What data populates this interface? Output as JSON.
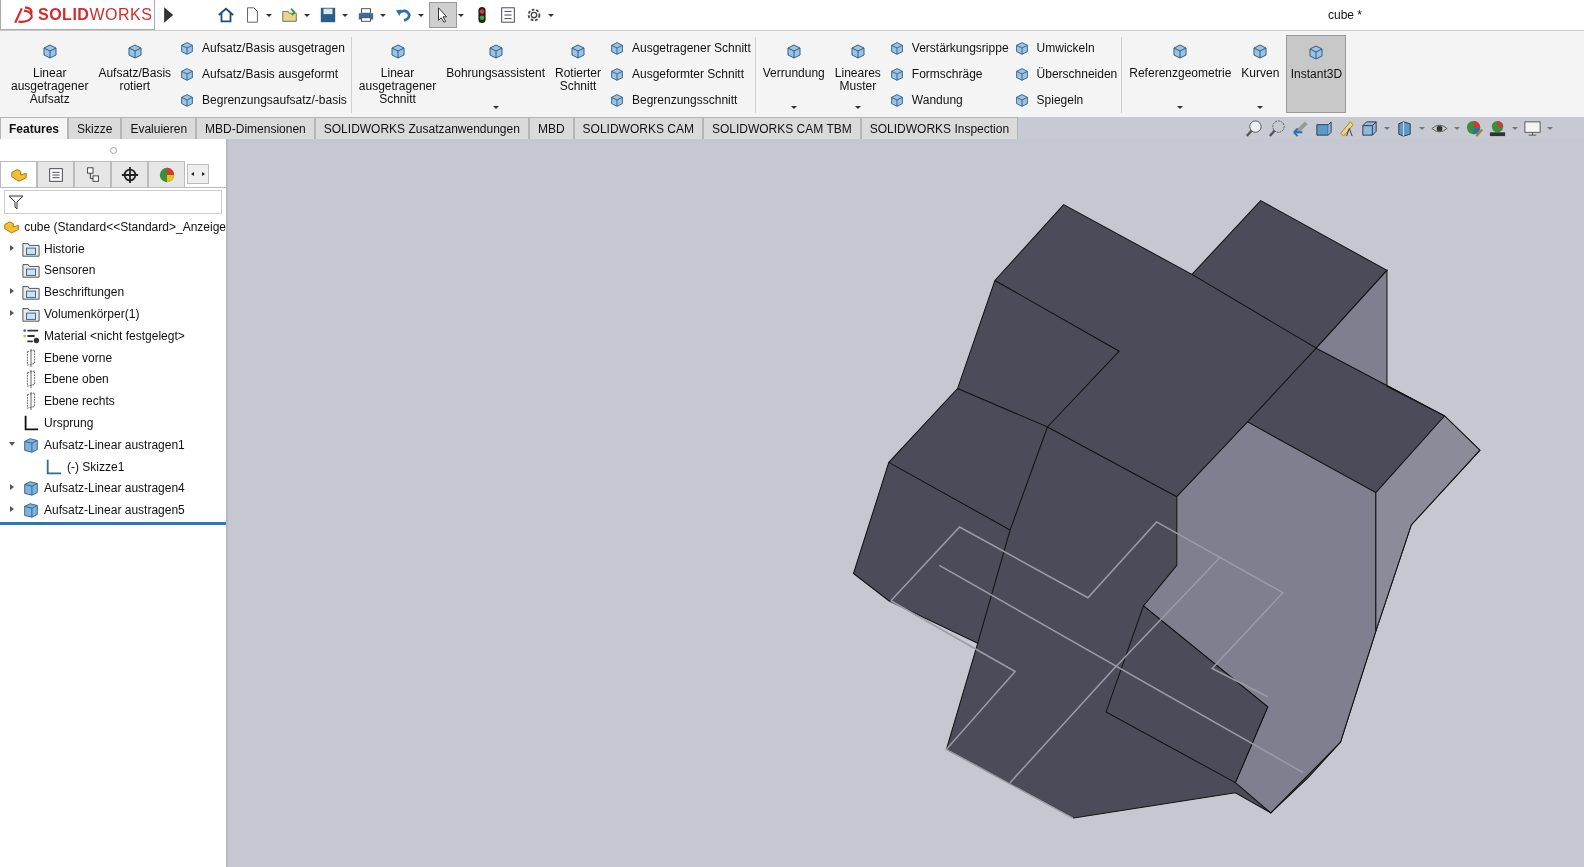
{
  "app": {
    "logo": "**SOLID**WORKS",
    "title": "cube *"
  },
  "ribbon": {
    "groups": [
      {
        "items": [
          {
            "kind": "large",
            "lines": [
              "Linear",
              "ausgetragener",
              "Aufsatz"
            ],
            "dropdown": false,
            "on": false
          },
          {
            "kind": "large",
            "lines": [
              "Aufsatz/Basis",
              "rotiert"
            ],
            "dropdown": false,
            "on": false
          },
          {
            "kind": "stack",
            "entries": [
              "Aufsatz/Basis ausgetragen",
              "Aufsatz/Basis ausgeformt",
              "Begrenzungsaufsatz/-basis"
            ]
          }
        ]
      },
      {
        "items": [
          {
            "kind": "large",
            "lines": [
              "Linear",
              "ausgetragener",
              "Schnitt"
            ],
            "dropdown": false,
            "on": false
          },
          {
            "kind": "large",
            "lines": [
              "Bohrungsassistent"
            ],
            "dropdown": true,
            "on": false
          },
          {
            "kind": "large",
            "lines": [
              "Rotierter",
              "Schnitt"
            ],
            "dropdown": false,
            "on": false
          },
          {
            "kind": "stack",
            "entries": [
              "Ausgetragener Schnitt",
              "Ausgeformter Schnitt",
              "Begrenzungsschnitt"
            ]
          }
        ]
      },
      {
        "items": [
          {
            "kind": "large",
            "lines": [
              "Verrundung"
            ],
            "dropdown": true,
            "on": false
          },
          {
            "kind": "large",
            "lines": [
              "Lineares",
              "Muster"
            ],
            "dropdown": true,
            "on": false
          },
          {
            "kind": "stack",
            "entries": [
              "Verstärkungsrippe",
              "Formschräge",
              "Wandung"
            ]
          },
          {
            "kind": "stack",
            "entries": [
              "Umwickeln",
              "Überschneiden",
              "Spiegeln"
            ]
          }
        ]
      },
      {
        "items": [
          {
            "kind": "large",
            "lines": [
              "Referenzgeometrie"
            ],
            "dropdown": true,
            "on": false
          },
          {
            "kind": "large",
            "lines": [
              "Kurven"
            ],
            "dropdown": true,
            "on": false
          },
          {
            "kind": "large",
            "lines": [
              "Instant3D"
            ],
            "dropdown": false,
            "on": true
          }
        ]
      }
    ]
  },
  "tabs": [
    {
      "label": "Features",
      "selected": true
    },
    {
      "label": "Skizze",
      "selected": false
    },
    {
      "label": "Evaluieren",
      "selected": false
    },
    {
      "label": "MBD-Dimensionen",
      "selected": false
    },
    {
      "label": "SOLIDWORKS Zusatzanwendungen",
      "selected": false
    },
    {
      "label": "MBD",
      "selected": false
    },
    {
      "label": "SOLIDWORKS CAM",
      "selected": false
    },
    {
      "label": "SOLIDWORKS CAM TBM",
      "selected": false
    },
    {
      "label": "SOLIDWORKS Inspection",
      "selected": false
    }
  ],
  "panel_tabs": [
    {
      "selected": true
    },
    {
      "selected": false
    },
    {
      "selected": false
    },
    {
      "selected": false
    },
    {
      "selected": false
    }
  ],
  "tree": {
    "root": "cube  (Standard<<Standard>_Anzeige",
    "items": [
      {
        "kind": "folder",
        "label": "Historie",
        "expanded": false
      },
      {
        "kind": "folder",
        "label": "Sensoren"
      },
      {
        "kind": "folder",
        "label": "Beschriftungen",
        "expanded": false
      },
      {
        "kind": "folder",
        "label": "Volumenkörper(1)",
        "expanded": false
      },
      {
        "kind": "material",
        "label": "Material <nicht festgelegt>"
      },
      {
        "kind": "plane",
        "label": "Ebene vorne"
      },
      {
        "kind": "plane",
        "label": "Ebene oben"
      },
      {
        "kind": "plane",
        "label": "Ebene rechts"
      },
      {
        "kind": "origin",
        "label": "Ursprung"
      },
      {
        "kind": "feature",
        "label": "Aufsatz-Linear austragen1",
        "expanded": true,
        "children": [
          {
            "kind": "sketch",
            "label": "(-) Skizze1"
          }
        ]
      },
      {
        "kind": "feature",
        "label": "Aufsatz-Linear austragen4",
        "expanded": false
      },
      {
        "kind": "feature",
        "label": "Aufsatz-Linear austragen5",
        "expanded": false
      }
    ]
  }
}
